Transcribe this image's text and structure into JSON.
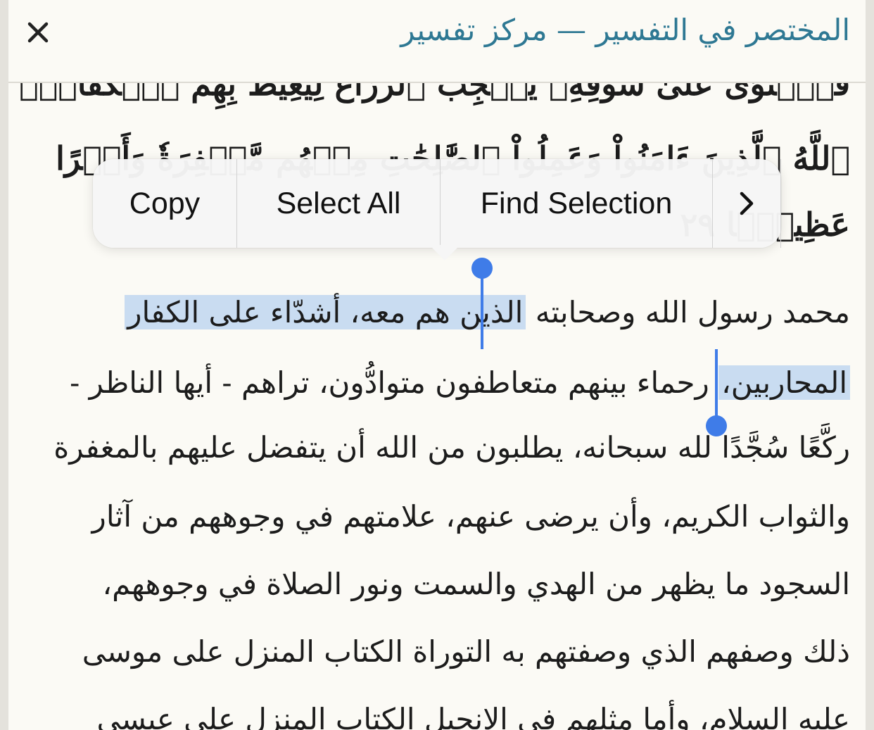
{
  "header": {
    "title": "المختصر في التفسير — مركز تفسير",
    "close_icon": "close-icon"
  },
  "verse": {
    "line1": "فَٱسۡتَوَىٰ عَلَىٰ سُوقِهِۦ يُعۡجِبُ ٱلزُّرَّاعَ لِيَغِيظَ بِهِمُ ٱلۡكُفَّارَۗ وَعَدَ",
    "line2": "ٱللَّهُ ٱلَّذِينَ ءَامَنُواْ وَعَمِلُواْ ٱلصَّٰلِحَٰتِ مِنۡهُم مَّغۡفِرَةٗ وَأَجۡرًا",
    "line3": "عَظِيمَۢا ٢٩"
  },
  "context_menu": {
    "copy": "Copy",
    "select_all": "Select All",
    "find_selection": "Find Selection",
    "more_icon": "chevron-right-icon"
  },
  "tafsir": {
    "line1_unselected": "محمد رسول الله وصحابته",
    "line1_selected": "الذين هم معه، أشدّاء على الكفار",
    "line2_selected": "المحاربين،",
    "line2_rest": "رحماء بينهم متعاطفون متوادُّون، تراهم - أيها الناظر -",
    "line3": "ركَّعًا سُجَّدًا لله سبحانه، يطلبون من الله أن يتفضل عليهم بالمغفرة",
    "line4": "والثواب الكريم، وأن يرضى عنهم، علامتهم في وجوههم من آثار",
    "line5": "السجود ما يظهر من الهدي والسمت ونور الصلاة في وجوههم،",
    "line6": "ذلك وصفهم الذي وصفتهم به التوراة الكتاب المنزل على موسى",
    "line7": "عليه السلام، وأما مثلهم في الإنجيل الكتاب المنزل على عيسى"
  },
  "colors": {
    "title": "#2e7893",
    "selection": "#78aaeb",
    "handle": "#3f7ce8",
    "background": "#fbfaf5"
  }
}
